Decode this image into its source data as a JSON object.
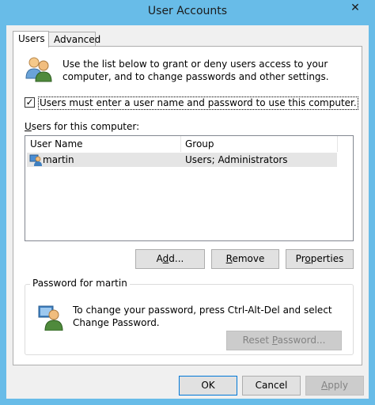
{
  "window": {
    "title": "User Accounts",
    "close_glyph": "✕"
  },
  "tabs": [
    {
      "label": "Users",
      "active": true
    },
    {
      "label": "Advanced",
      "active": false
    }
  ],
  "intro_text": "Use the list below to grant or deny users access to your computer, and to change passwords and other settings.",
  "must_login": {
    "label": "Users must enter a user name and password to use this computer.",
    "checked": true,
    "check_glyph": "✓"
  },
  "users_list": {
    "label": "Users for this computer:",
    "columns": [
      "User Name",
      "Group"
    ],
    "rows": [
      {
        "user_name": "martin",
        "group": "Users; Administrators",
        "selected": true
      }
    ]
  },
  "list_buttons": {
    "add": {
      "pre": "A",
      "u": "d",
      "post": "d..."
    },
    "remove": {
      "pre": "",
      "u": "R",
      "post": "emove"
    },
    "properties": {
      "pre": "Pr",
      "u": "o",
      "post": "perties"
    }
  },
  "password_group": {
    "title": "Password for martin",
    "text": "To change your password, press Ctrl-Alt-Del and select Change Password.",
    "reset_button": {
      "pre": "Reset ",
      "u": "P",
      "post": "assword..."
    }
  },
  "dialog_buttons": {
    "ok": "OK",
    "cancel": "Cancel",
    "apply": {
      "pre": "",
      "u": "A",
      "post": "pply"
    }
  },
  "colors": {
    "frame": "#68bce8",
    "client_bg": "#f0f0f0",
    "selection": "#e5e5e5",
    "default_border": "#0078d7"
  },
  "icons": {
    "users_icon": "users-group-icon",
    "user_icon": "user-icon",
    "password_icon": "user-password-icon"
  }
}
